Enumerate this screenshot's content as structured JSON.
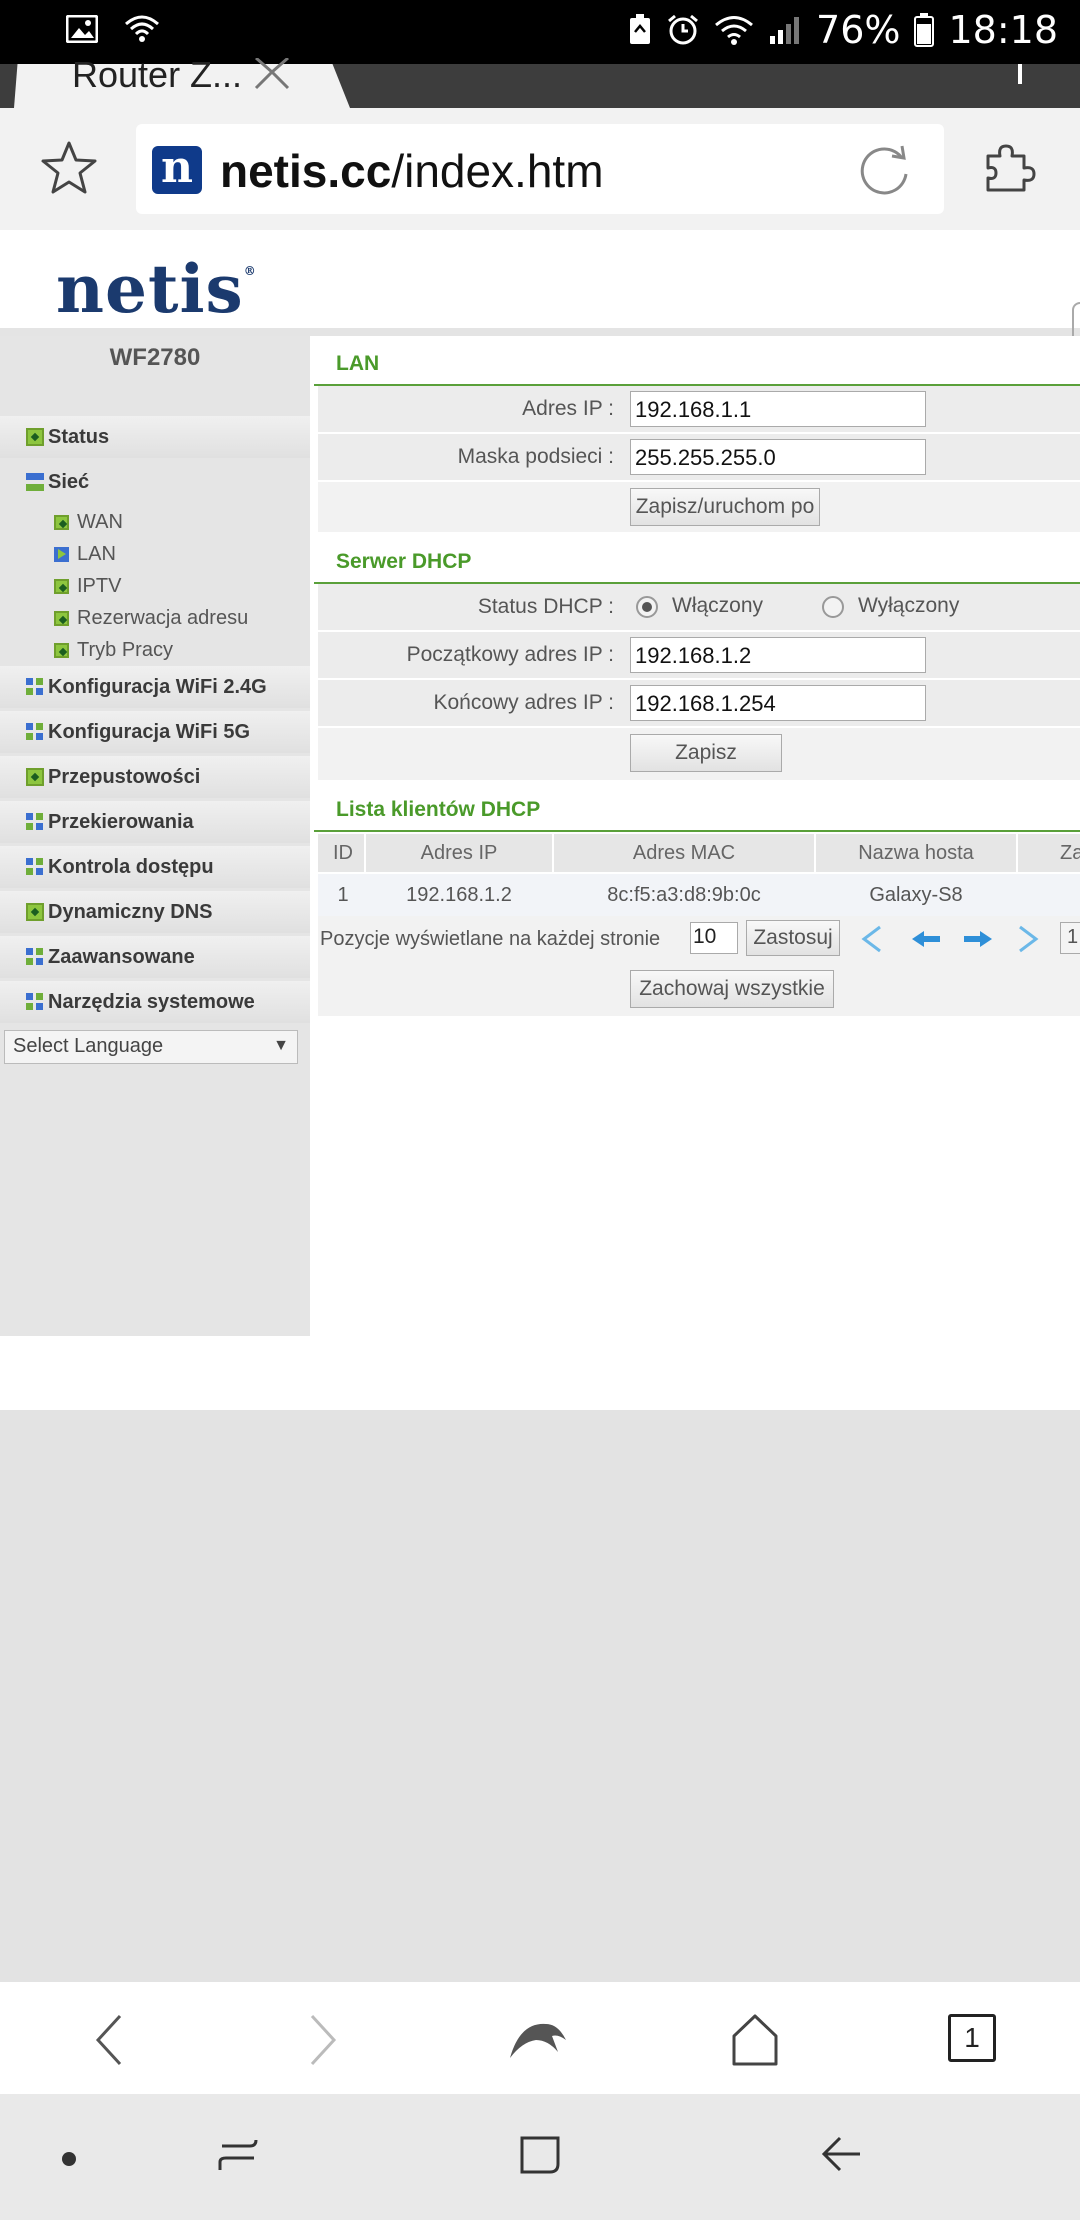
{
  "status_bar": {
    "battery": "76%",
    "time": "18:18"
  },
  "browser": {
    "tab_title": "Router Z...",
    "url_domain": "netis.cc",
    "url_path": "/index.htm",
    "favicon_letter": "n",
    "tab_count": "1"
  },
  "page": {
    "logo": "netis",
    "logo_mark": "®",
    "model": "WF2780"
  },
  "sidebar": {
    "items": [
      {
        "label": "Status"
      },
      {
        "label": "Sieć"
      },
      {
        "label": "Konfiguracja WiFi 2.4G"
      },
      {
        "label": "Konfiguracja WiFi 5G"
      },
      {
        "label": "Przepustowości"
      },
      {
        "label": "Przekierowania"
      },
      {
        "label": "Kontrola dostępu"
      },
      {
        "label": "Dynamiczny DNS"
      },
      {
        "label": "Zaawansowane"
      },
      {
        "label": "Narzędzia systemowe"
      }
    ],
    "sub_items": [
      {
        "label": "WAN"
      },
      {
        "label": "LAN"
      },
      {
        "label": "IPTV"
      },
      {
        "label": "Rezerwacja adresu"
      },
      {
        "label": "Tryb Pracy"
      }
    ],
    "language": "Select Language"
  },
  "lan": {
    "title": "LAN",
    "ip_label": "Adres IP :",
    "ip_value": "192.168.1.1",
    "mask_label": "Maska podsieci :",
    "mask_value": "255.255.255.0",
    "save_restart": "Zapisz/uruchom po"
  },
  "dhcp": {
    "title": "Serwer DHCP",
    "status_label": "Status DHCP :",
    "on": "Włączony",
    "off": "Wyłączony",
    "start_label": "Początkowy adres IP :",
    "start_value": "192.168.1.2",
    "end_label": "Końcowy adres IP :",
    "end_value": "192.168.1.254",
    "save": "Zapisz"
  },
  "clients": {
    "title": "Lista klientów DHCP",
    "headers": [
      "ID",
      "Adres IP",
      "Adres MAC",
      "Nazwa hosta",
      "Za"
    ],
    "rows": [
      [
        "1",
        "192.168.1.2",
        "8c:f5:a3:d8:9b:0c",
        "Galaxy-S8"
      ]
    ],
    "per_page_label": "Pozycje wyświetlane na każdej stronie",
    "per_page_value": "10",
    "apply": "Zastosuj",
    "page_num": "1",
    "save_all": "Zachowaj wszystkie"
  }
}
